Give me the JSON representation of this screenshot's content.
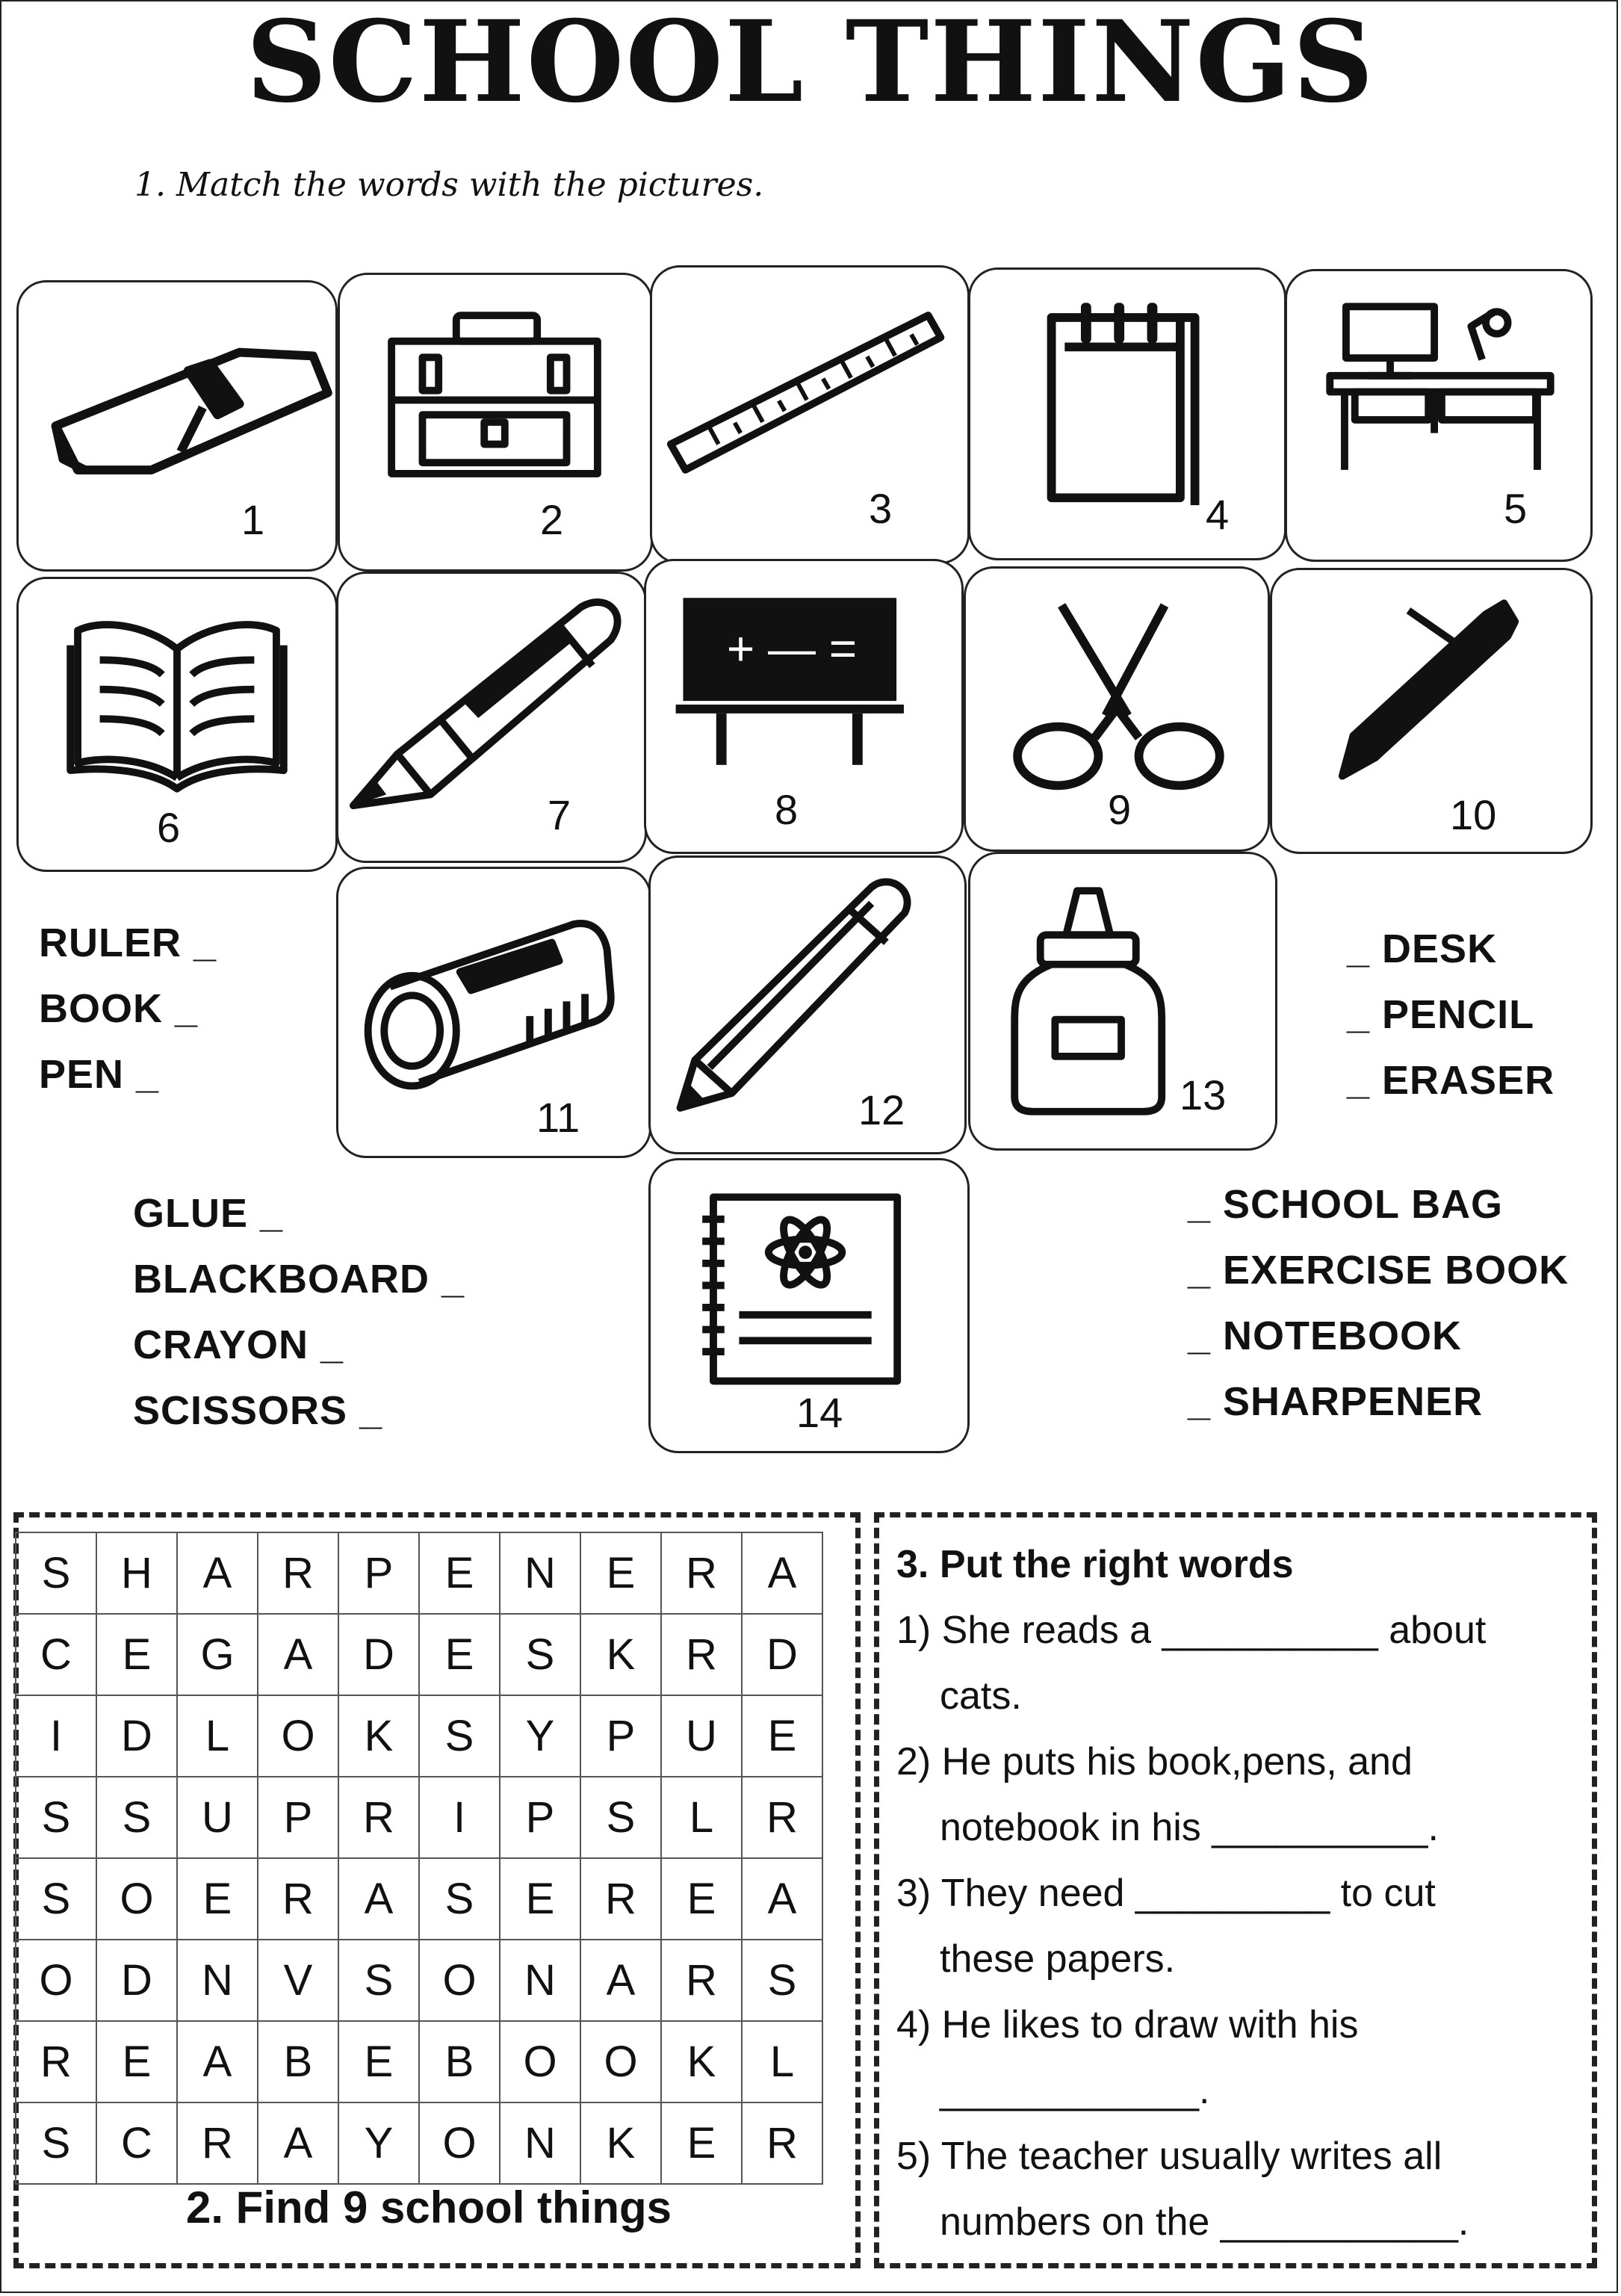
{
  "title": "SCHOOL THINGS",
  "instruction": "1. Match the words with the pictures.",
  "cards": [
    {
      "number": "1",
      "icon": "eraser-icon"
    },
    {
      "number": "2",
      "icon": "school-bag-icon"
    },
    {
      "number": "3",
      "icon": "ruler-icon"
    },
    {
      "number": "4",
      "icon": "notebook-icon"
    },
    {
      "number": "5",
      "icon": "desk-icon"
    },
    {
      "number": "6",
      "icon": "book-icon"
    },
    {
      "number": "7",
      "icon": "crayon-icon"
    },
    {
      "number": "8",
      "icon": "blackboard-icon"
    },
    {
      "number": "9",
      "icon": "scissors-icon"
    },
    {
      "number": "10",
      "icon": "pen-icon"
    },
    {
      "number": "11",
      "icon": "sharpener-icon"
    },
    {
      "number": "12",
      "icon": "pencil-icon"
    },
    {
      "number": "13",
      "icon": "glue-icon"
    },
    {
      "number": "14",
      "icon": "exercise-book-icon"
    }
  ],
  "blackboard_symbols": "+ — =",
  "words_left_top": [
    "RULER _",
    "BOOK _",
    "PEN _"
  ],
  "words_right_top": [
    "_ DESK",
    "_ PENCIL",
    "_ ERASER"
  ],
  "words_left_bottom": [
    "GLUE _",
    "BLACKBOARD _",
    "CRAYON _",
    "SCISSORS _"
  ],
  "words_right_bottom": [
    "_ SCHOOL BAG",
    "_ EXERCISE BOOK",
    "_ NOTEBOOK",
    "_ SHARPENER"
  ],
  "wordsearch": {
    "rows": [
      [
        "S",
        "H",
        "A",
        "R",
        "P",
        "E",
        "N",
        "E",
        "R",
        "A"
      ],
      [
        "C",
        "E",
        "G",
        "A",
        "D",
        "E",
        "S",
        "K",
        "R",
        "D"
      ],
      [
        "I",
        "D",
        "L",
        "O",
        "K",
        "S",
        "Y",
        "P",
        "U",
        "E"
      ],
      [
        "S",
        "S",
        "U",
        "P",
        "R",
        "I",
        "P",
        "S",
        "L",
        "R"
      ],
      [
        "S",
        "O",
        "E",
        "R",
        "A",
        "S",
        "E",
        "R",
        "E",
        "A"
      ],
      [
        "O",
        "D",
        "N",
        "V",
        "S",
        "O",
        "N",
        "A",
        "R",
        "S"
      ],
      [
        "R",
        "E",
        "A",
        "B",
        "E",
        "B",
        "O",
        "O",
        "K",
        "L"
      ],
      [
        "S",
        "C",
        "R",
        "A",
        "Y",
        "O",
        "N",
        "K",
        "E",
        "R"
      ]
    ],
    "caption": "2. Find 9 school things"
  },
  "exercise3": {
    "heading": "3. Put the right words",
    "lines": [
      "1) She reads a __________ about",
      "cats.",
      "2) He puts his book,pens, and",
      "notebook in his __________.",
      "3) They need _________ to cut",
      "these papers.",
      "4) He likes to draw with his",
      "____________.",
      "5) The teacher usually writes all",
      "numbers on the ___________."
    ]
  }
}
